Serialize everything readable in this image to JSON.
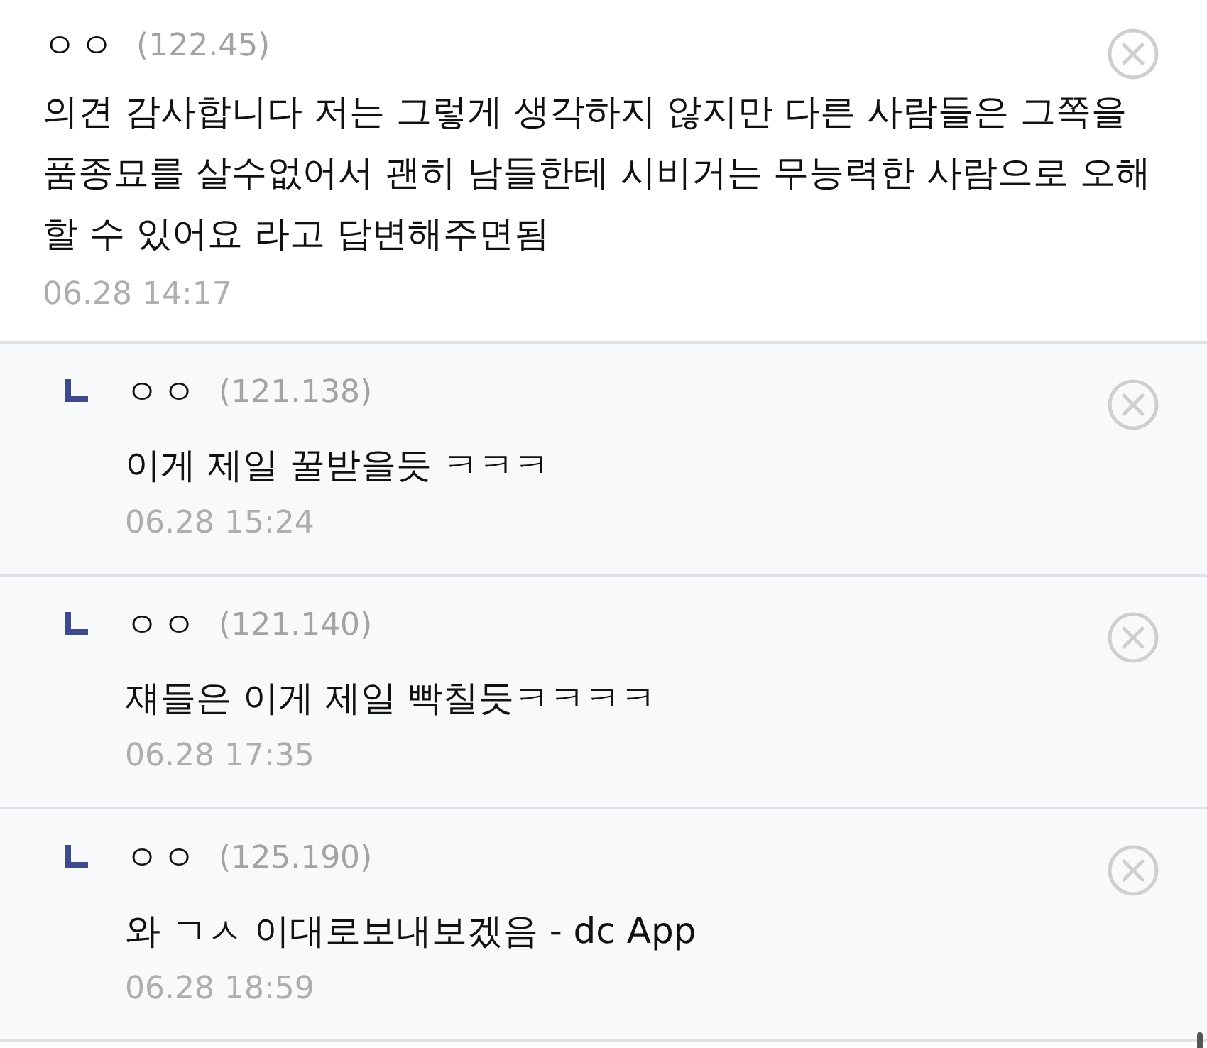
{
  "comments": [
    {
      "kind": "comment",
      "nickname": "ㅇㅇ",
      "ip": "(122.45)",
      "text": "의견 감사합니다 저는 그렇게 생각하지 않지만 다른 사람들은 그쪽을 품종묘를 살수없어서 괜히 남들한테 시비거는 무능력한 사람으로 오해할 수 있어요 라고 답변해주면됨",
      "date": "06.28 14:17"
    },
    {
      "kind": "reply",
      "nickname": "ㅇㅇ",
      "ip": "(121.138)",
      "text": "이게 제일 꿀받을듯 ㅋㅋㅋ",
      "date": "06.28 15:24"
    },
    {
      "kind": "reply",
      "nickname": "ㅇㅇ",
      "ip": "(121.140)",
      "text": "쟤들은 이게 제일 빡칠듯ㅋㅋㅋㅋ",
      "date": "06.28 17:35"
    },
    {
      "kind": "reply",
      "nickname": "ㅇㅇ",
      "ip": "(125.190)",
      "text": "와 ㄱㅅ 이대로보내보겠음 - dc App",
      "date": "06.28 18:59"
    }
  ]
}
